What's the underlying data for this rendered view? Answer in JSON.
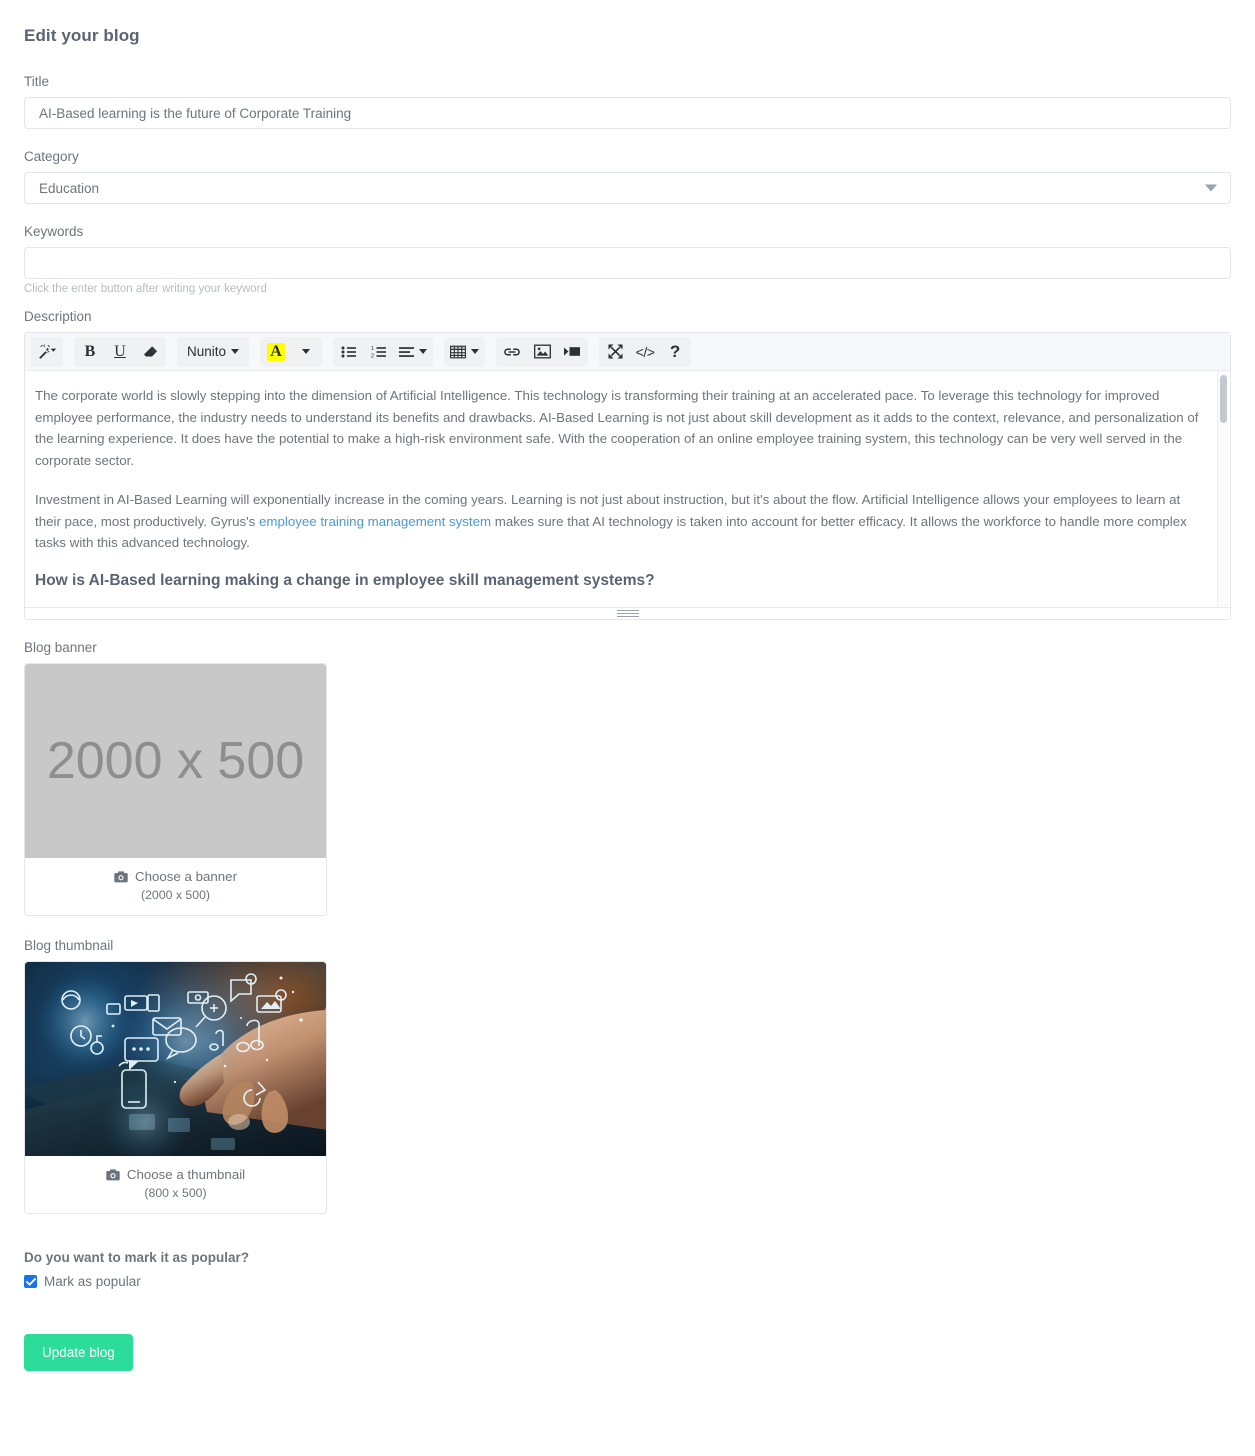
{
  "header": {
    "title": "Edit your blog"
  },
  "form": {
    "title": {
      "label": "Title",
      "value": "AI-Based learning is the future of Corporate Training",
      "placeholder": ""
    },
    "category": {
      "label": "Category",
      "value": "Education",
      "options": [
        "Education"
      ],
      "caret_icon": "chevron-down-icon"
    },
    "keywords": {
      "label": "Keywords",
      "value": "",
      "placeholder": "",
      "hint": "Click the enter button after writing your keyword"
    },
    "description": {
      "label": "Description",
      "toolbar": {
        "groups": [
          {
            "items": [
              {
                "name": "magic-wand-icon",
                "label": "",
                "icon": "magic-wand"
              }
            ]
          },
          {
            "items": [
              {
                "name": "bold-button",
                "label": "B",
                "icon": "bold"
              },
              {
                "name": "underline-button",
                "label": "U",
                "icon": "underline"
              },
              {
                "name": "eraser-button",
                "label": "",
                "icon": "eraser"
              }
            ]
          },
          {
            "items": [
              {
                "name": "font-family-dropdown",
                "label": "Nunito",
                "icon": "text-with-caret"
              }
            ]
          },
          {
            "items": [
              {
                "name": "text-color-button",
                "label": "A",
                "icon": "highlighted-a"
              },
              {
                "name": "text-color-dropdown",
                "label": "",
                "icon": "caret-only"
              }
            ]
          },
          {
            "items": [
              {
                "name": "unordered-list-button",
                "label": "",
                "icon": "bullet-list"
              },
              {
                "name": "ordered-list-button",
                "label": "",
                "icon": "numbered-list"
              },
              {
                "name": "paragraph-align-dropdown",
                "label": "",
                "icon": "align-with-caret"
              }
            ]
          },
          {
            "items": [
              {
                "name": "table-dropdown",
                "label": "",
                "icon": "table-with-caret"
              }
            ]
          },
          {
            "items": [
              {
                "name": "insert-link-button",
                "label": "",
                "icon": "link"
              },
              {
                "name": "insert-image-button",
                "label": "",
                "icon": "image"
              },
              {
                "name": "insert-video-button",
                "label": "",
                "icon": "video"
              }
            ]
          },
          {
            "items": [
              {
                "name": "fullscreen-button",
                "label": "",
                "icon": "expand-arrows"
              },
              {
                "name": "code-view-button",
                "label": "</>",
                "icon": "code"
              },
              {
                "name": "help-button",
                "label": "?",
                "icon": "question-mark"
              }
            ]
          }
        ]
      },
      "content": {
        "paragraph_1": "The corporate world is slowly stepping into the dimension of Artificial Intelligence. This technology is transforming their training at an accelerated pace. To leverage this technology for improved employee performance, the industry needs to understand its benefits and drawbacks. AI-Based Learning is not just about skill development as it adds to the context, relevance, and personalization of the learning experience. It does have the potential to make a high-risk environment safe. With the cooperation of an online employee training system, this technology can be very well served in the corporate sector.",
        "paragraph_2_before_link": "Investment in AI-Based Learning will exponentially increase in the coming years. Learning is not just about instruction, but it's about the flow. Artificial Intelligence allows your employees to learn at their pace, most productively. Gyrus's ",
        "paragraph_2_link": "employee training management system",
        "paragraph_2_after_link": " makes sure that AI technology is taken into account for better efficacy. It allows the workforce to handle more complex tasks with this advanced technology.",
        "heading_1": "How is AI-Based learning making a change in employee skill management systems?"
      }
    },
    "banner": {
      "label": "Blog banner",
      "placeholder_text": "2000 x 500",
      "choose_label": "Choose a banner",
      "dimensions": "(2000 x 500)",
      "camera_icon": "camera-icon"
    },
    "thumbnail": {
      "label": "Blog thumbnail",
      "choose_label": "Choose a thumbnail",
      "dimensions": "(800 x 500)",
      "camera_icon": "camera-icon"
    },
    "popular": {
      "question": "Do you want to mark it as popular?",
      "checkbox_label": "Mark as popular",
      "checked": true
    },
    "submit": {
      "label": "Update blog"
    }
  },
  "colors": {
    "accent_green": "#2bdc9a",
    "link_blue": "#4b9ad4",
    "checkbox_blue": "#1a73e8",
    "highlight_yellow": "#ffff00",
    "text_gray": "#6c757d"
  }
}
